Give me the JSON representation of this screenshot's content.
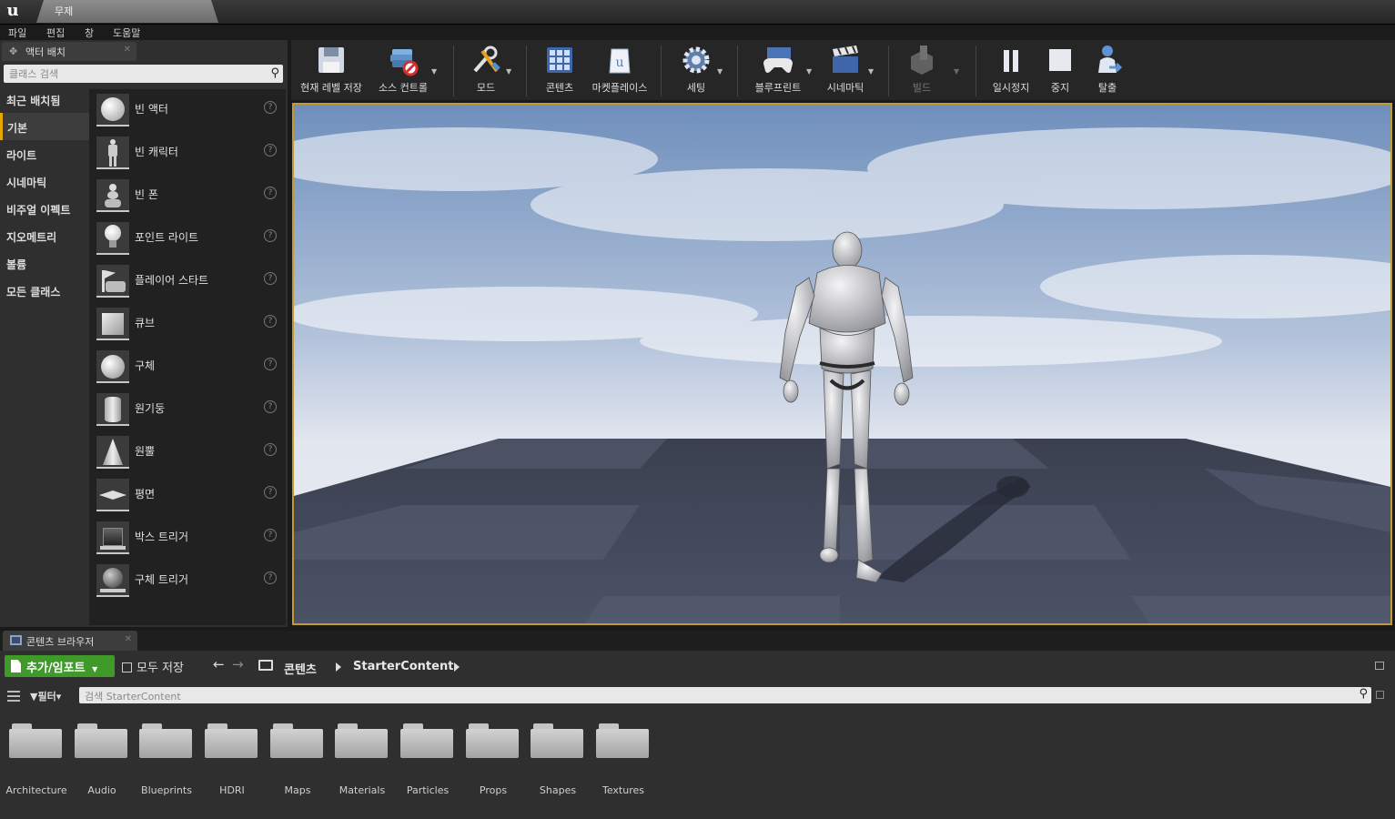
{
  "window": {
    "doc_tab": "무제"
  },
  "menu": [
    "파일",
    "편집",
    "창",
    "도움말"
  ],
  "place_panel": {
    "tab_label": "액터 배치",
    "search_placeholder": "클래스 검색",
    "categories": [
      "최근 배치됨",
      "기본",
      "라이트",
      "시네마틱",
      "비주얼 이펙트",
      "지오메트리",
      "볼륨",
      "모든 클래스"
    ],
    "selected_category": "기본",
    "actors": [
      {
        "label": "빈 액터",
        "icon": "sphere-icon"
      },
      {
        "label": "빈 캐릭터",
        "icon": "mannequin-icon"
      },
      {
        "label": "빈 폰",
        "icon": "pawn-icon"
      },
      {
        "label": "포인트 라이트",
        "icon": "light-bulb-icon"
      },
      {
        "label": "플레이어 스타트",
        "icon": "player-start-icon"
      },
      {
        "label": "큐브",
        "icon": "cube-icon"
      },
      {
        "label": "구체",
        "icon": "sphere-icon"
      },
      {
        "label": "원기둥",
        "icon": "cylinder-icon"
      },
      {
        "label": "원뿔",
        "icon": "cone-icon"
      },
      {
        "label": "평면",
        "icon": "plane-icon"
      },
      {
        "label": "박스 트리거",
        "icon": "box-trigger-icon"
      },
      {
        "label": "구체 트리거",
        "icon": "sphere-trigger-icon"
      }
    ]
  },
  "toolbar": {
    "save": "현재 레벨 저장",
    "source_control": "소스 컨트롤",
    "modes": "모드",
    "content": "콘텐츠",
    "marketplace": "마켓플레이스",
    "settings": "세팅",
    "blueprints": "블루프린트",
    "cinematics": "시네마틱",
    "build": "빌드",
    "pause": "일시정지",
    "stop": "중지",
    "eject": "탈출"
  },
  "content_browser": {
    "tab_label": "콘텐츠 브라우저",
    "add_import": "추가/임포트",
    "save_all": "모두 저장",
    "breadcrumb": [
      "콘텐츠",
      "StarterContent"
    ],
    "filters": "필터",
    "search_placeholder": "검색 StarterContent",
    "folders": [
      "Architecture",
      "Audio",
      "Blueprints",
      "HDRI",
      "Maps",
      "Materials",
      "Particles",
      "Props",
      "Shapes",
      "Textures"
    ]
  }
}
